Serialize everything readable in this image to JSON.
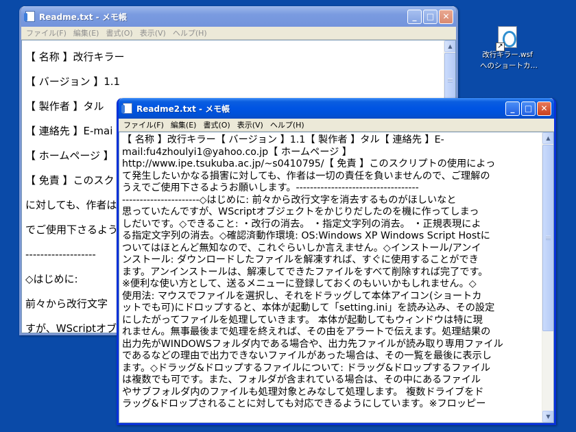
{
  "desktop": {
    "icon_label_line1": "改行キラー.wsf",
    "icon_label_line2": "へのショートカ…"
  },
  "window_back": {
    "title": "Readme.txt - メモ帳",
    "menu": [
      "ファイル(F)",
      "編集(E)",
      "書式(O)",
      "表示(V)",
      "ヘルプ(H)"
    ],
    "lines": [
      "【 名称 】改行キラー",
      "【 バージョン 】1.1",
      "【 製作者 】タル",
      "【 連絡先 】E-mai",
      "【 ホームページ 】",
      "【 免責 】このスク",
      "に対しても、作者は",
      "でご使用下さるよう",
      "-------------------",
      "◇はじめに:",
      "  前々から改行文字",
      "すが、WScriptオブ"
    ]
  },
  "window_front": {
    "title": "Readme2.txt - メモ帳",
    "menu": [
      "ファイル(F)",
      "編集(E)",
      "書式(O)",
      "表示(V)",
      "ヘルプ(H)"
    ],
    "lines": [
      " 【 名称 】改行キラー【 バージョン 】1.1【 製作者 】タル【 連絡先 】E-",
      "mail:fu4zhoulyi1@yahoo.co.jp【 ホームページ 】",
      "http://www.ipe.tsukuba.ac.jp/~s0410795/【 免責 】このスクリプトの使用によっ",
      "て発生したいかなる損害に対しても、作者は一切の責任を負いませんので、ご理解の",
      "うえでご使用下さるようお願いします。-----------------------------------",
      "----------------------◇はじめに: 前々から改行文字を消去するものがほしいなと",
      "思っていたんですが、WScriptオブジェクトをかじりだしたのを機に作ってしまっ",
      "しだいです。◇できること: ・改行の消去。 ・指定文字列の消去。 ・正規表現によ",
      "る指定文字列の消去。◇確認済動作環境: OS:Windows XP Windows Script Hostに",
      "ついてはほとんど無知なので、これぐらいしか言えません。◇インストール/アンイ",
      "ンストール: ダウンロードしたファイルを解凍すれば、すぐに使用することができ",
      "ます。アンインストールは、解凍してできたファイルをすべて削除すれば完了です。",
      "  ※便利な使い方として、送るメニューに登録しておくのもいいかもしれません。◇",
      "使用法: マウスでファイルを選択し、それをドラッグして本体アイコン(ショートカ",
      "ットでも可)にドロップすると、本体が起動して「setting.ini」を読み込み、その設定",
      "にしたがってファイルを処理していきます。 本体が起動してもウィンドウは特に現",
      "れません。無事最後まで処理を終えれば、その由をアラートで伝えます。処理結果の",
      "出力先がWINDOWSフォルダ内である場合や、出力先ファイルが読み取り専用ファイル",
      "であるなどの理由で出力できないファイルがあった場合は、その一覧を最後に表示し",
      "ます。◇ドラッグ&ドロップするファイルについて: ドラッグ&ドロップするファイル",
      "は複数でも可です。また、フォルダが含まれている場合は、その中にあるファイル",
      "やサブフォルダ内のファイルも処理対象とみなして処理します。 複数ドライブをド",
      "ラッグ&ドロップされることに対しても対応できるようにしています。※フロッピー"
    ]
  },
  "colors": {
    "desktop": "#0a4aa8",
    "active_title": "#0054e3",
    "inactive_title": "#7a9be0"
  }
}
